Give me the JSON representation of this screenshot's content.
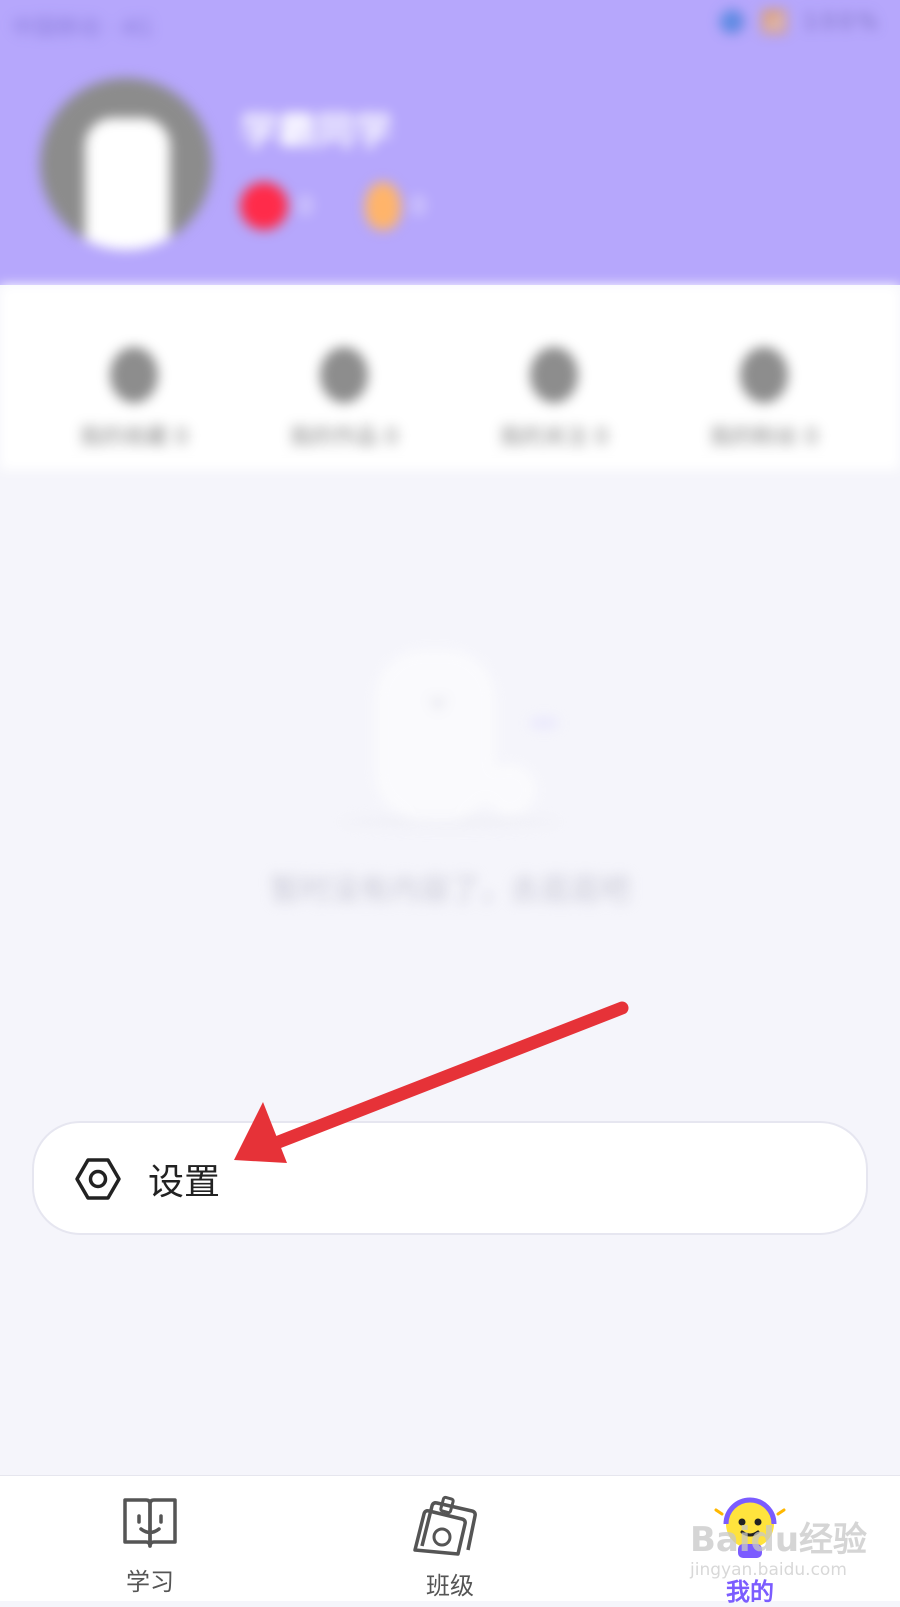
{
  "status_bar": {
    "left": "中国移动 · 4G",
    "right": "🔵 📶 100%"
  },
  "profile": {
    "username": "学霸同学",
    "stat_red": "0",
    "stat_fire": "0"
  },
  "quick_actions": [
    {
      "label": "我的收藏 0"
    },
    {
      "label": "我的作品 0"
    },
    {
      "label": "我的关注 0"
    },
    {
      "label": "我的粉丝 0"
    }
  ],
  "empty_state": {
    "text": "暂时没有内容了，去逛逛吧"
  },
  "settings": {
    "label": "设置"
  },
  "tabs": {
    "learn": "学习",
    "class": "班级",
    "me": "我的"
  },
  "watermark": {
    "main": "Baidu经验",
    "sub": "jingyan.baidu.com"
  },
  "colors": {
    "header_bg": "#b6a7fc",
    "page_bg": "#f5f5fb",
    "arrow_red": "#e63238",
    "accent_purple": "#7b5cff"
  }
}
